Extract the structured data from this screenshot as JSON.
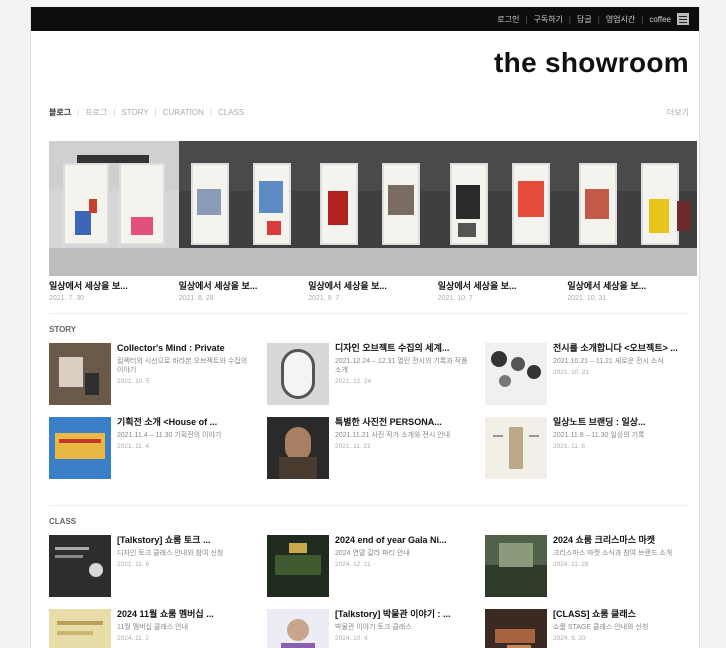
{
  "topbar": {
    "links": [
      "로그인",
      "구독하기",
      "답글",
      "영업시간",
      "coffee"
    ],
    "menu_icon": "menu-icon"
  },
  "brand": {
    "title": "the showroom"
  },
  "nav": {
    "items": [
      "블로그",
      "프로그",
      "STORY",
      "CURATION",
      "CLASS"
    ],
    "more": "더보기"
  },
  "slides": [
    {
      "title": "일상에서 세상을 보...",
      "date": "2021. 7. 30"
    },
    {
      "title": "일상에서 세상을 보...",
      "date": "2021. 8. 28"
    },
    {
      "title": "일상에서 세상을 보...",
      "date": "2021. 9. 7"
    },
    {
      "title": "일상에서 세상을 보...",
      "date": "2021. 10. 7"
    },
    {
      "title": "일상에서 세상을 보...",
      "date": "2021. 10. 31"
    }
  ],
  "story": {
    "heading": "STORY",
    "items": [
      {
        "title": "Collector's Mind : Private",
        "snippet": "컬렉터의 시선으로 바라본 오브젝트와 수집의 이야기",
        "date": "2021. 10. 5"
      },
      {
        "title": "디자인 오브젝트 수집의 세계...",
        "snippet": "2021.12.24 – 12.31 열린 전시의 기록과 작품 소개",
        "date": "2021. 12. 24"
      },
      {
        "title": "전시를 소개합니다 <오브젝트> ...",
        "snippet": "2021.10.21 – 11.21 새로운 전시 소식",
        "date": "2021. 10. 21"
      },
      {
        "title": "기획전 소개 <House of ...",
        "snippet": "2021.11.4 – 11.30 기획전의 이야기",
        "date": "2021. 11. 4"
      },
      {
        "title": "특별한 사진전 PERSONA...",
        "snippet": "2021.11.21 사진 작가 소개와 전시 안내",
        "date": "2021. 11. 21"
      },
      {
        "title": "일상노트 브랜딩 : 일상...",
        "snippet": "2021.11.8 – 11.30 일상의 기록",
        "date": "2021. 11. 8"
      }
    ]
  },
  "class": {
    "heading": "CLASS",
    "items": [
      {
        "title": "[Talkstory] 쇼룸 토크 ...",
        "snippet": "디자인 토크 클래스 안내와 참여 신청",
        "date": "2021. 11. 9"
      },
      {
        "title": "2024 end of year Gala Ni...",
        "snippet": "2024 연말 갈라 파티 안내",
        "date": "2024. 12. 11"
      },
      {
        "title": "2024 쇼룸 크리스마스 마켓",
        "snippet": "크리스마스 마켓 소식과 참여 브랜드 소개",
        "date": "2024. 11. 28"
      },
      {
        "title": "2024 11월 쇼룸 멤버십 ...",
        "snippet": "11월 멤버십 클래스 안내",
        "date": "2024. 11. 2"
      },
      {
        "title": "[Talkstory] 박물관 이야기 : ...",
        "snippet": "박물관 이야기 토크 클래스",
        "date": "2024. 10. 4"
      },
      {
        "title": "[CLASS] 쇼룸 클래스",
        "snippet": "쇼룸 STAGE 클래스 안내와 신청",
        "date": "2024. 9. 20"
      }
    ]
  }
}
